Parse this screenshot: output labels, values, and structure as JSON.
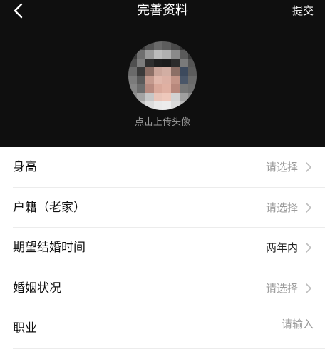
{
  "nav": {
    "title": "完善资料",
    "submit_label": "提交",
    "back_icon": "chevron-left-icon"
  },
  "profile": {
    "avatar_hint": "点击上传头像"
  },
  "form": {
    "rows": [
      {
        "label": "身高",
        "value": "请选择",
        "state": "placeholder",
        "icon": "chevron-right-icon"
      },
      {
        "label": "户籍（老家）",
        "value": "请选择",
        "state": "placeholder",
        "icon": "chevron-right-icon"
      },
      {
        "label": "期望结婚时间",
        "value": "两年内",
        "state": "filled",
        "icon": "chevron-right-icon"
      },
      {
        "label": "婚姻状况",
        "value": "请选择",
        "state": "placeholder",
        "icon": "chevron-right-icon"
      },
      {
        "label": "职业",
        "value": "请输入",
        "state": "placeholder"
      }
    ]
  },
  "colors": {
    "header_bg": "#0f0f0f",
    "placeholder": "#9a9a9a",
    "divider": "#ececec"
  }
}
